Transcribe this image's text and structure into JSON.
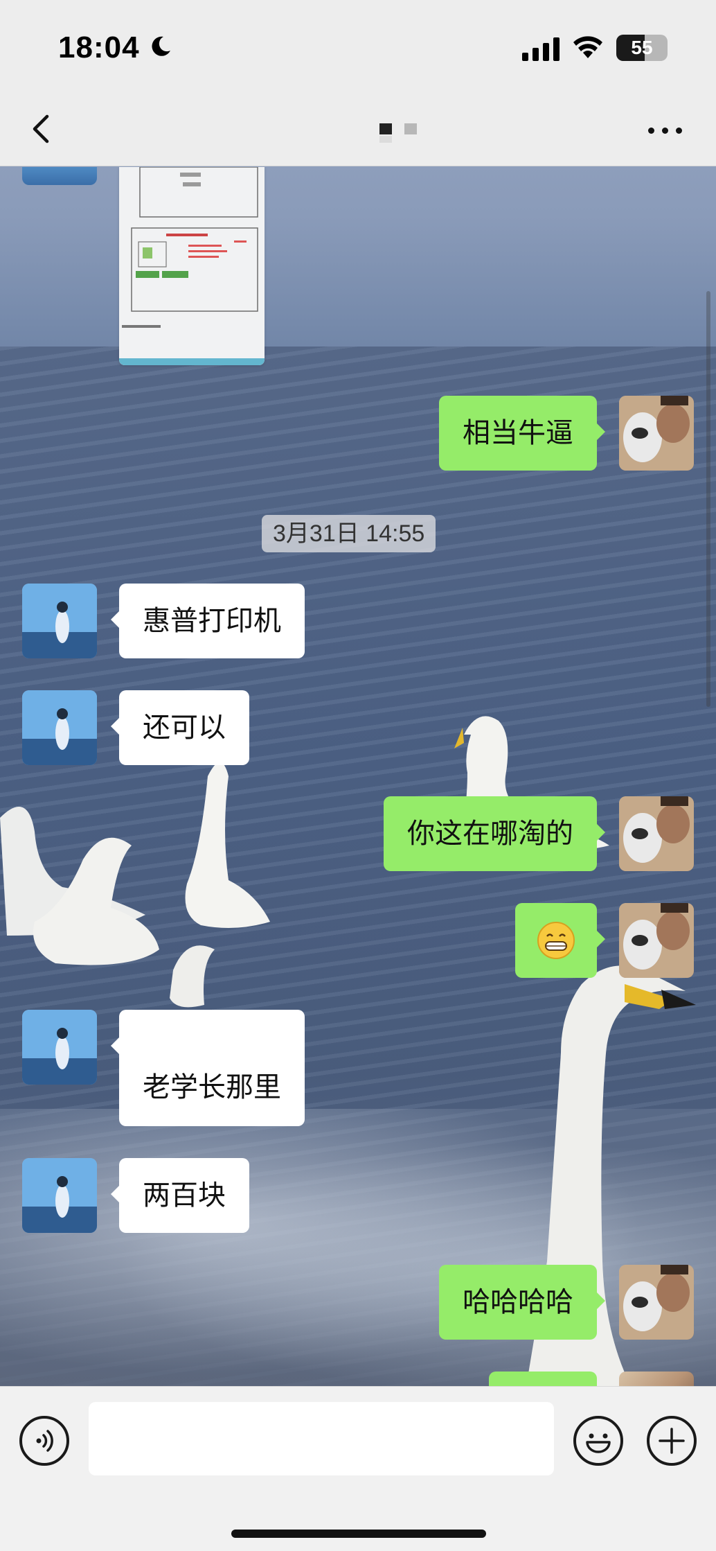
{
  "status_bar": {
    "time": "18:04",
    "battery_level": "55",
    "battery_fraction": 0.55,
    "icons": [
      "moon-icon",
      "cellular-signal-icon",
      "wifi-icon",
      "battery-icon"
    ]
  },
  "nav": {
    "back_icon": "chevron-left-icon",
    "more_icon": "more-dots-icon"
  },
  "messages": [
    {
      "side": "other",
      "type": "image",
      "avatar": "avatar-other"
    },
    {
      "side": "self",
      "type": "text",
      "text": "相当牛逼"
    },
    {
      "type": "timestamp",
      "text": "3月31日 14:55"
    },
    {
      "side": "other",
      "type": "text",
      "text": "惠普打印机"
    },
    {
      "side": "other",
      "type": "text",
      "text": "还可以"
    },
    {
      "side": "self",
      "type": "text",
      "text": "你这在哪淘的"
    },
    {
      "side": "self",
      "type": "emoji",
      "icon": "grin-emoji-icon"
    },
    {
      "side": "other",
      "type": "text",
      "text": "老学长那里"
    },
    {
      "side": "other",
      "type": "text",
      "text": "两百块"
    },
    {
      "side": "self",
      "type": "text",
      "text": "哈哈哈哈"
    }
  ],
  "input_bar": {
    "voice_icon": "voice-icon",
    "input_value": "",
    "emoji_icon": "emoji-icon",
    "plus_icon": "plus-icon"
  },
  "colors": {
    "self_bubble": "#95ec69",
    "other_bubble": "#ffffff",
    "bar_background": "#ededed"
  }
}
